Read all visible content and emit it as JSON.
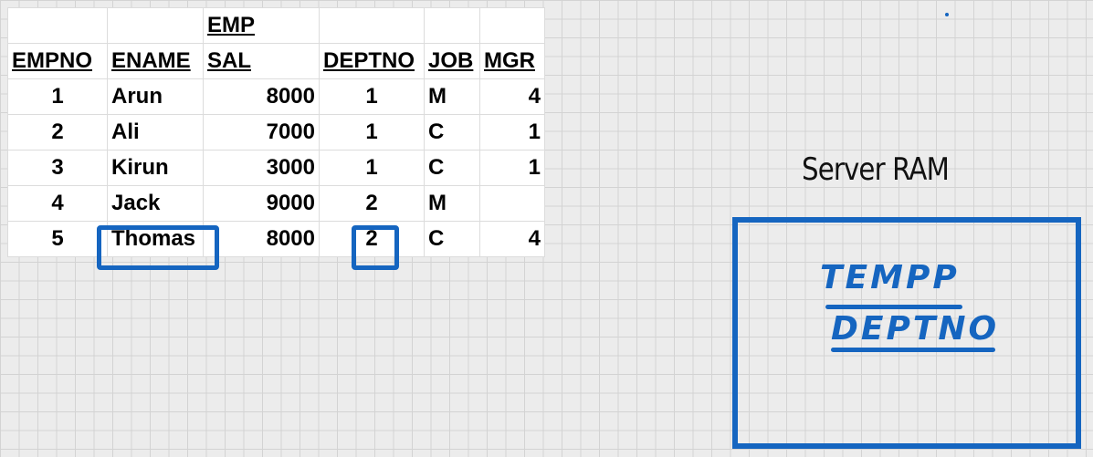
{
  "table": {
    "title": "EMP",
    "headers": [
      "EMPNO",
      "ENAME",
      "SAL",
      "DEPTNO",
      "JOB",
      "MGR"
    ],
    "rows": [
      [
        "1",
        "Arun",
        "8000",
        "1",
        "M",
        "4"
      ],
      [
        "2",
        "Ali",
        "7000",
        "1",
        "C",
        "1"
      ],
      [
        "3",
        "Kirun",
        "3000",
        "1",
        "C",
        "1"
      ],
      [
        "4",
        "Jack",
        "9000",
        "2",
        "M",
        ""
      ],
      [
        "5",
        "Thomas",
        "8000",
        "2",
        "C",
        "4"
      ]
    ]
  },
  "server": {
    "label": "Server RAM",
    "words": [
      "TEMPP",
      "DEPTNO"
    ]
  },
  "colors": {
    "highlight": "#1565c0"
  }
}
